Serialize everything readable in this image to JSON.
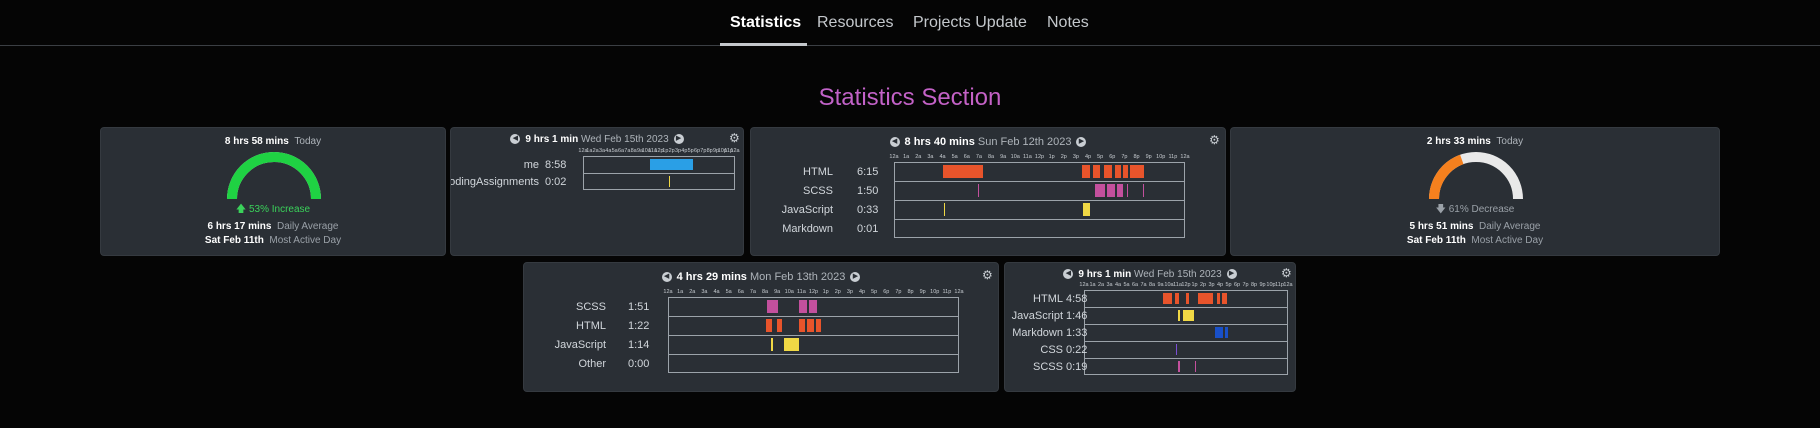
{
  "nav": {
    "tabs": [
      {
        "label": "Statistics",
        "active": true
      },
      {
        "label": "Resources",
        "active": false
      },
      {
        "label": "Projects Update",
        "active": false
      },
      {
        "label": "Notes",
        "active": false
      }
    ]
  },
  "section_title": "Statistics Section",
  "colors": {
    "html": "#e8542b",
    "scss": "#c3509d",
    "javascript": "#f0d845",
    "markdown": "#1950c8",
    "css": "#7b4fd6",
    "me": "#2a9fe6",
    "gauge_green": "#1fd243",
    "gauge_orange": "#f5801e",
    "gauge_gray": "#e9e9e9"
  },
  "cards": {
    "today_left": {
      "total": "8 hrs 58 mins",
      "period": "Today",
      "gauge_fraction": 1.0,
      "change_text": "53% Increase",
      "change_direction": "up",
      "avg_value": "6 hrs 17 mins",
      "avg_label": "Daily Average",
      "active_value": "Sat Feb 11th",
      "active_label": "Most Active Day"
    },
    "projects": {
      "total": "9 hrs 1 min",
      "date": "Wed Feb 15th 2023",
      "ticks": [
        "12a",
        "1a",
        "2a",
        "3a",
        "4a",
        "5a",
        "6a",
        "7a",
        "8a",
        "9a",
        "10a",
        "11a",
        "12p",
        "1p",
        "2p",
        "3p",
        "4p",
        "5p",
        "6p",
        "7p",
        "8p",
        "9p",
        "10p",
        "11p",
        "12a"
      ],
      "rows": [
        {
          "label": "me",
          "time": "8:58",
          "color": "me",
          "segments": [
            [
              10.5,
              17.3
            ]
          ]
        },
        {
          "label": "myCodingAssignments",
          "time": "0:02",
          "color": "javascript",
          "segments": [
            [
              13.5,
              13.6
            ]
          ]
        }
      ]
    },
    "sun": {
      "total": "8 hrs 40 mins",
      "date": "Sun Feb 12th 2023",
      "ticks": [
        "12a",
        "1a",
        "2a",
        "3a",
        "4a",
        "5a",
        "6a",
        "7a",
        "8a",
        "9a",
        "10a",
        "11a",
        "12p",
        "1p",
        "2p",
        "3p",
        "4p",
        "5p",
        "6p",
        "7p",
        "8p",
        "9p",
        "10p",
        "11p",
        "12a"
      ],
      "rows": [
        {
          "label": "HTML",
          "time": "6:15",
          "color": "html",
          "segments": [
            [
              4.0,
              7.3
            ],
            [
              15.5,
              16.2
            ],
            [
              16.4,
              17.0
            ],
            [
              17.3,
              18.0
            ],
            [
              18.2,
              18.7
            ],
            [
              18.9,
              19.3
            ],
            [
              19.5,
              20.6
            ]
          ]
        },
        {
          "label": "SCSS",
          "time": "1:50",
          "color": "scss",
          "segments": [
            [
              6.9,
              7.0
            ],
            [
              16.6,
              17.4
            ],
            [
              17.6,
              18.2
            ],
            [
              18.4,
              18.9
            ],
            [
              19.2,
              19.3
            ],
            [
              20.5,
              20.6
            ]
          ]
        },
        {
          "label": "JavaScript",
          "time": "0:33",
          "color": "javascript",
          "segments": [
            [
              4.1,
              4.2
            ],
            [
              15.6,
              16.2
            ]
          ]
        },
        {
          "label": "Markdown",
          "time": "0:01",
          "color": "markdown",
          "segments": []
        }
      ]
    },
    "today_right": {
      "total": "2 hrs 33 mins",
      "period": "Today",
      "gauge_fraction": 0.39,
      "change_text": "61% Decrease",
      "change_direction": "down",
      "avg_value": "5 hrs 51 mins",
      "avg_label": "Daily Average",
      "active_value": "Sat Feb 11th",
      "active_label": "Most Active Day"
    },
    "mon": {
      "total": "4 hrs 29 mins",
      "date": "Mon Feb 13th 2023",
      "ticks": [
        "12a",
        "1a",
        "2a",
        "3a",
        "4a",
        "5a",
        "6a",
        "7a",
        "8a",
        "9a",
        "10a",
        "11a",
        "12p",
        "1p",
        "2p",
        "3p",
        "4p",
        "5p",
        "6p",
        "7p",
        "8p",
        "9p",
        "10p",
        "11p",
        "12a"
      ],
      "rows": [
        {
          "label": "SCSS",
          "time": "1:51",
          "color": "scss",
          "segments": [
            [
              8.2,
              9.1
            ],
            [
              10.8,
              11.5
            ],
            [
              11.6,
              12.3
            ]
          ]
        },
        {
          "label": "HTML",
          "time": "1:22",
          "color": "html",
          "segments": [
            [
              8.1,
              8.6
            ],
            [
              9.0,
              9.4
            ],
            [
              10.8,
              11.3
            ],
            [
              11.5,
              12.0
            ],
            [
              12.2,
              12.6
            ]
          ]
        },
        {
          "label": "JavaScript",
          "time": "1:14",
          "color": "javascript",
          "segments": [
            [
              8.5,
              8.7
            ],
            [
              9.6,
              10.8
            ]
          ]
        },
        {
          "label": "Other",
          "time": "0:00",
          "color": "css",
          "segments": []
        }
      ]
    },
    "wed": {
      "total": "9 hrs 1 min",
      "date": "Wed Feb 15th 2023",
      "ticks": [
        "12a",
        "1a",
        "2a",
        "3a",
        "4a",
        "5a",
        "6a",
        "7a",
        "8a",
        "9a",
        "10a",
        "11a",
        "12p",
        "1p",
        "2p",
        "3p",
        "4p",
        "5p",
        "6p",
        "7p",
        "8p",
        "9p",
        "10p",
        "11p",
        "12a"
      ],
      "rows": [
        {
          "label": "HTML",
          "time": "4:58",
          "color": "html",
          "segments": [
            [
              9.3,
              10.3
            ],
            [
              10.7,
              11.2
            ],
            [
              12.0,
              12.3
            ],
            [
              13.4,
              15.2
            ],
            [
              15.6,
              16.0
            ],
            [
              16.2,
              16.8
            ]
          ]
        },
        {
          "label": "JavaScript",
          "time": "1:46",
          "color": "javascript",
          "segments": [
            [
              11.0,
              11.3
            ],
            [
              11.6,
              13.0
            ]
          ]
        },
        {
          "label": "Markdown",
          "time": "1:33",
          "color": "markdown",
          "segments": [
            [
              15.4,
              16.4
            ],
            [
              16.6,
              16.9
            ]
          ]
        },
        {
          "label": "CSS",
          "time": "0:22",
          "color": "css",
          "segments": [
            [
              10.8,
              11.0
            ]
          ]
        },
        {
          "label": "SCSS",
          "time": "0:19",
          "color": "scss",
          "segments": [
            [
              11.1,
              11.3
            ],
            [
              13.0,
              13.1
            ]
          ]
        }
      ]
    }
  }
}
